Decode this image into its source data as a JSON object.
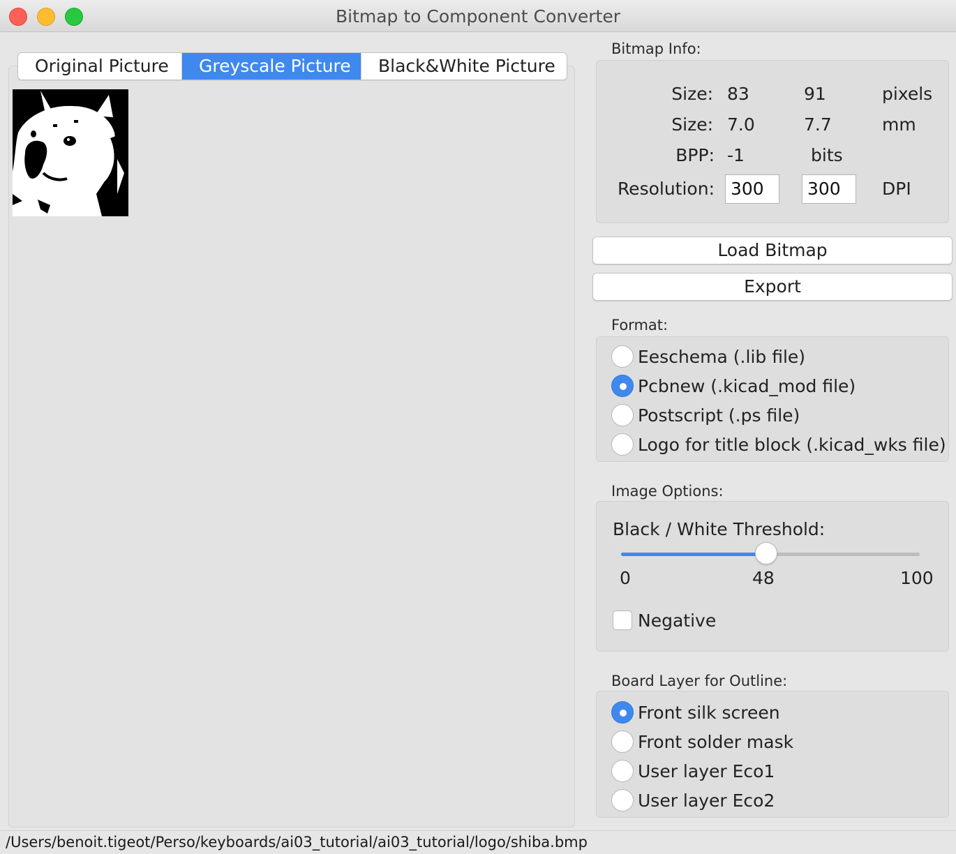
{
  "window": {
    "title": "Bitmap to Component Converter"
  },
  "tabs": [
    {
      "label": "Original Picture",
      "active": false
    },
    {
      "label": "Greyscale Picture",
      "active": true
    },
    {
      "label": "Black&White Picture",
      "active": false
    }
  ],
  "preview": {
    "icon": "shiba-dog-bitmap-icon"
  },
  "bitmap_info": {
    "heading": "Bitmap Info:",
    "size_px": {
      "label": "Size:",
      "w": "83",
      "h": "91",
      "unit": "pixels"
    },
    "size_mm": {
      "label": "Size:",
      "w": "7.0",
      "h": "7.7",
      "unit": "mm"
    },
    "bpp": {
      "label": "BPP:",
      "value": "-1",
      "unit": "bits"
    },
    "resolution": {
      "label": "Resolution:",
      "x": "300",
      "y": "300",
      "unit": "DPI"
    }
  },
  "buttons": {
    "load": "Load Bitmap",
    "export": "Export"
  },
  "format": {
    "heading": "Format:",
    "options": [
      {
        "label": "Eeschema (.lib file)",
        "selected": false
      },
      {
        "label": "Pcbnew (.kicad_mod file)",
        "selected": true
      },
      {
        "label": "Postscript (.ps file)",
        "selected": false
      },
      {
        "label": "Logo for title block (.kicad_wks file)",
        "selected": false
      }
    ]
  },
  "image_options": {
    "heading": "Image Options:",
    "threshold_label": "Black / White Threshold:",
    "slider": {
      "min": "0",
      "value": "48",
      "max": "100"
    },
    "negative_label": "Negative",
    "negative_checked": false
  },
  "board_layer": {
    "heading": "Board Layer for Outline:",
    "options": [
      {
        "label": "Front silk screen",
        "selected": true
      },
      {
        "label": "Front solder mask",
        "selected": false
      },
      {
        "label": "User layer Eco1",
        "selected": false
      },
      {
        "label": "User layer Eco2",
        "selected": false
      }
    ]
  },
  "status": {
    "path": "/Users/benoit.tigeot/Perso/keyboards/ai03_tutorial/ai03_tutorial/logo/shiba.bmp"
  },
  "colors": {
    "accent": "#3f88ee",
    "window_bg": "#e6e6e6"
  }
}
